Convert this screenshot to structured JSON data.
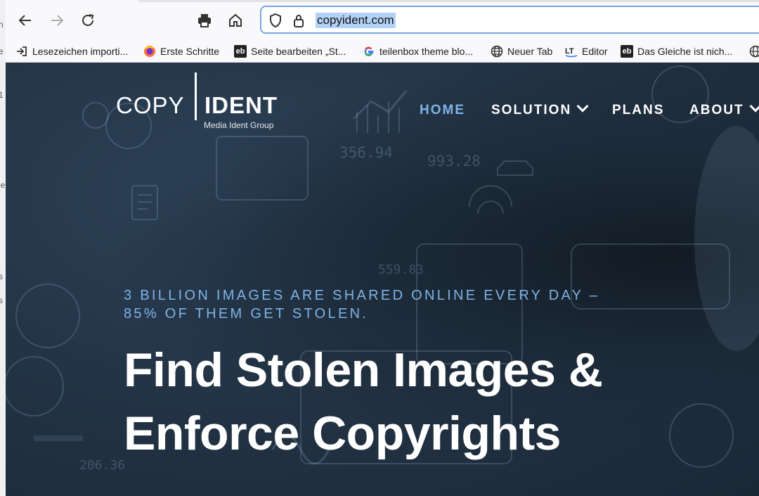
{
  "browser": {
    "url": "copyident.com",
    "nav_icons": [
      "back-icon",
      "forward-icon",
      "reload-icon",
      "print-icon",
      "home-icon",
      "shield-icon",
      "lock-icon"
    ],
    "bookmarks": [
      {
        "label": "Lesezeichen importi...",
        "icon": "import-icon"
      },
      {
        "label": "Erste Schritte",
        "icon": "firefox-icon"
      },
      {
        "label": "Seite bearbeiten „St...",
        "icon": "eb-icon"
      },
      {
        "label": "teilenbox theme blo...",
        "icon": "google-icon"
      },
      {
        "label": "Neuer Tab",
        "icon": "globe-icon"
      },
      {
        "label": "Editor",
        "icon": "languagetool-icon"
      },
      {
        "label": "Das Gleiche ist nich...",
        "icon": "eb-icon"
      }
    ]
  },
  "site": {
    "logo": {
      "left": "COPY",
      "right": "IDENT",
      "sub": "Media Ident Group"
    },
    "nav": [
      {
        "label": "HOME",
        "active": true
      },
      {
        "label": "SOLUTION",
        "dropdown": true
      },
      {
        "label": "PLANS"
      },
      {
        "label": "ABOUT",
        "dropdown": true
      }
    ],
    "tagline_line1": "3 BILLION IMAGES ARE SHARED ONLINE EVERY DAY –",
    "tagline_line2": "85% OF THEM GET STOLEN.",
    "headline_line1": "Find Stolen Images &",
    "headline_line2": "Enforce Copyrights",
    "background_numbers": [
      "356.94",
      "993.28",
      "559.83",
      "206.36"
    ]
  },
  "colors": {
    "accent": "#7fb3e6",
    "hero_bg": "#233446",
    "url_highlight": "#b3d2f7"
  }
}
